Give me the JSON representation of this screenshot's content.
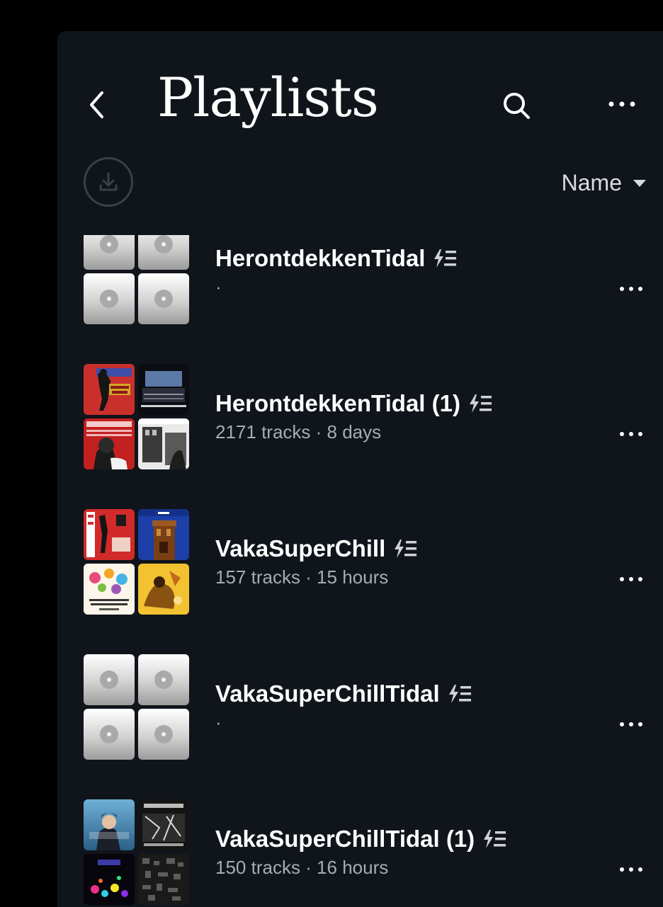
{
  "header": {
    "title": "Playlists",
    "back_icon": "chevron-left-icon",
    "search_icon": "search-icon",
    "more_icon": "more-horizontal-icon"
  },
  "toolbar": {
    "download_icon": "download-icon",
    "sort_label": "Name",
    "sort_icon": "caret-down-icon"
  },
  "playlists": [
    {
      "name": "HerontdekkenTidal",
      "subtitle": "·",
      "artwork": [
        "placeholder",
        "placeholder",
        "placeholder",
        "placeholder"
      ]
    },
    {
      "name": "HerontdekkenTidal (1)",
      "subtitle": "2171 tracks · 8 days",
      "artwork": [
        "album-skinhead-train",
        "album-orchestra",
        "album-ahmad-jamal",
        "album-street"
      ]
    },
    {
      "name": "VakaSuperChill",
      "subtitle": "157 tracks · 15 hours",
      "artwork": [
        "album-red-poster",
        "album-blue-tower",
        "album-colorful-poster",
        "album-yellow-abstract"
      ]
    },
    {
      "name": "VakaSuperChillTidal",
      "subtitle": "·",
      "artwork": [
        "placeholder",
        "placeholder",
        "placeholder",
        "placeholder"
      ]
    },
    {
      "name": "VakaSuperChillTidal (1)",
      "subtitle": "150 tracks · 16 hours",
      "artwork": [
        "album-sinatra",
        "album-dark-collage",
        "album-colorful-lights",
        "album-dark-grid"
      ]
    }
  ],
  "playlist_badge_icon": "smart-playlist-icon",
  "row_more_icon": "more-horizontal-icon",
  "colors": {
    "background": "#000000",
    "panel": "#10141b",
    "text_primary": "#ffffff",
    "text_secondary": "#a7abb3"
  }
}
